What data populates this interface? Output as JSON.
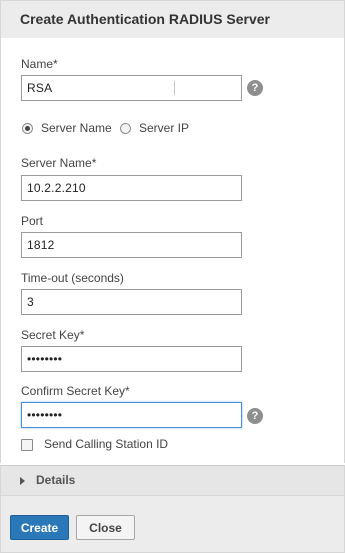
{
  "dialog": {
    "title": "Create Authentication RADIUS Server"
  },
  "form": {
    "name": {
      "label": "Name*",
      "value": "RSA"
    },
    "server_type": {
      "options": [
        "Server Name",
        "Server IP"
      ],
      "selected": "Server Name"
    },
    "server_name": {
      "label": "Server Name*",
      "value": "10.2.2.210"
    },
    "port": {
      "label": "Port",
      "value": "1812"
    },
    "timeout": {
      "label": "Time-out (seconds)",
      "value": "3"
    },
    "secret_key": {
      "label": "Secret Key*",
      "value": "••••••••"
    },
    "confirm_secret_key": {
      "label": "Confirm Secret Key*",
      "value": "••••••••"
    },
    "send_calling_station_id": {
      "label": "Send Calling Station ID",
      "checked": false
    },
    "help_glyph": "?"
  },
  "details": {
    "label": "Details",
    "icon": "triangle-right-icon"
  },
  "footer": {
    "create_label": "Create",
    "close_label": "Close"
  },
  "colors": {
    "primary_button": "#2a78b8",
    "focus_border": "#4a90d9",
    "header_bg": "#ececec"
  }
}
